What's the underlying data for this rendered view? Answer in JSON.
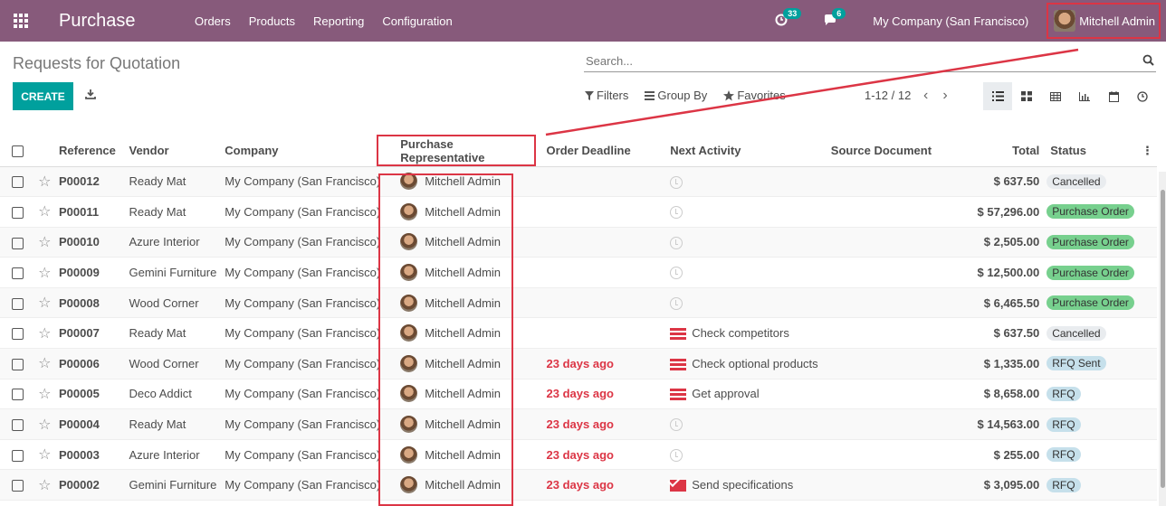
{
  "topbar": {
    "app_name": "Purchase",
    "menu": [
      "Orders",
      "Products",
      "Reporting",
      "Configuration"
    ],
    "activity_count": "33",
    "message_count": "6",
    "company": "My Company (San Francisco)",
    "user": "Mitchell Admin",
    "bg_color": "#875a7b"
  },
  "controlpanel": {
    "title": "Requests for Quotation",
    "search_placeholder": "Search...",
    "create_label": "CREATE",
    "filters_label": "Filters",
    "groupby_label": "Group By",
    "favorites_label": "Favorites",
    "pager": "1-12 / 12"
  },
  "table": {
    "headers": {
      "reference": "Reference",
      "vendor": "Vendor",
      "company": "Company",
      "representative": "Purchase Representative",
      "deadline": "Order Deadline",
      "activity": "Next Activity",
      "source": "Source Document",
      "total": "Total",
      "status": "Status"
    },
    "rows": [
      {
        "ref": "P00012",
        "vendor": "Ready Mat",
        "company": "My Company (San Francisco)",
        "rep": "Mitchell Admin",
        "deadline": "",
        "activity": "",
        "activity_icon": "clock",
        "total": "$ 637.50",
        "status": "Cancelled",
        "status_color": "#e9ecef"
      },
      {
        "ref": "P00011",
        "vendor": "Ready Mat",
        "company": "My Company (San Francisco)",
        "rep": "Mitchell Admin",
        "deadline": "",
        "activity": "",
        "activity_icon": "clock",
        "total": "$ 57,296.00",
        "status": "Purchase Order",
        "status_color": "#77d08e"
      },
      {
        "ref": "P00010",
        "vendor": "Azure Interior",
        "company": "My Company (San Francisco)",
        "rep": "Mitchell Admin",
        "deadline": "",
        "activity": "",
        "activity_icon": "clock",
        "total": "$ 2,505.00",
        "status": "Purchase Order",
        "status_color": "#77d08e"
      },
      {
        "ref": "P00009",
        "vendor": "Gemini Furniture",
        "company": "My Company (San Francisco)",
        "rep": "Mitchell Admin",
        "deadline": "",
        "activity": "",
        "activity_icon": "clock",
        "total": "$ 12,500.00",
        "status": "Purchase Order",
        "status_color": "#77d08e"
      },
      {
        "ref": "P00008",
        "vendor": "Wood Corner",
        "company": "My Company (San Francisco)",
        "rep": "Mitchell Admin",
        "deadline": "",
        "activity": "",
        "activity_icon": "clock",
        "total": "$ 6,465.50",
        "status": "Purchase Order",
        "status_color": "#77d08e"
      },
      {
        "ref": "P00007",
        "vendor": "Ready Mat",
        "company": "My Company (San Francisco)",
        "rep": "Mitchell Admin",
        "deadline": "",
        "activity": "Check competitors",
        "activity_icon": "todo",
        "total": "$ 637.50",
        "status": "Cancelled",
        "status_color": "#e9ecef"
      },
      {
        "ref": "P00006",
        "vendor": "Wood Corner",
        "company": "My Company (San Francisco)",
        "rep": "Mitchell Admin",
        "deadline": "23 days ago",
        "activity": "Check optional products",
        "activity_icon": "todo",
        "total": "$ 1,335.00",
        "status": "RFQ Sent",
        "status_color": "#c6e0eb"
      },
      {
        "ref": "P00005",
        "vendor": "Deco Addict",
        "company": "My Company (San Francisco)",
        "rep": "Mitchell Admin",
        "deadline": "23 days ago",
        "activity": "Get approval",
        "activity_icon": "todo",
        "total": "$ 8,658.00",
        "status": "RFQ",
        "status_color": "#c6e0eb"
      },
      {
        "ref": "P00004",
        "vendor": "Ready Mat",
        "company": "My Company (San Francisco)",
        "rep": "Mitchell Admin",
        "deadline": "23 days ago",
        "activity": "",
        "activity_icon": "clock",
        "total": "$ 14,563.00",
        "status": "RFQ",
        "status_color": "#c6e0eb"
      },
      {
        "ref": "P00003",
        "vendor": "Azure Interior",
        "company": "My Company (San Francisco)",
        "rep": "Mitchell Admin",
        "deadline": "23 days ago",
        "activity": "",
        "activity_icon": "clock",
        "total": "$ 255.00",
        "status": "RFQ",
        "status_color": "#c6e0eb"
      },
      {
        "ref": "P00002",
        "vendor": "Gemini Furniture",
        "company": "My Company (San Francisco)",
        "rep": "Mitchell Admin",
        "deadline": "23 days ago",
        "activity": "Send specifications",
        "activity_icon": "mail",
        "total": "$ 3,095.00",
        "status": "RFQ",
        "status_color": "#c6e0eb"
      }
    ]
  }
}
